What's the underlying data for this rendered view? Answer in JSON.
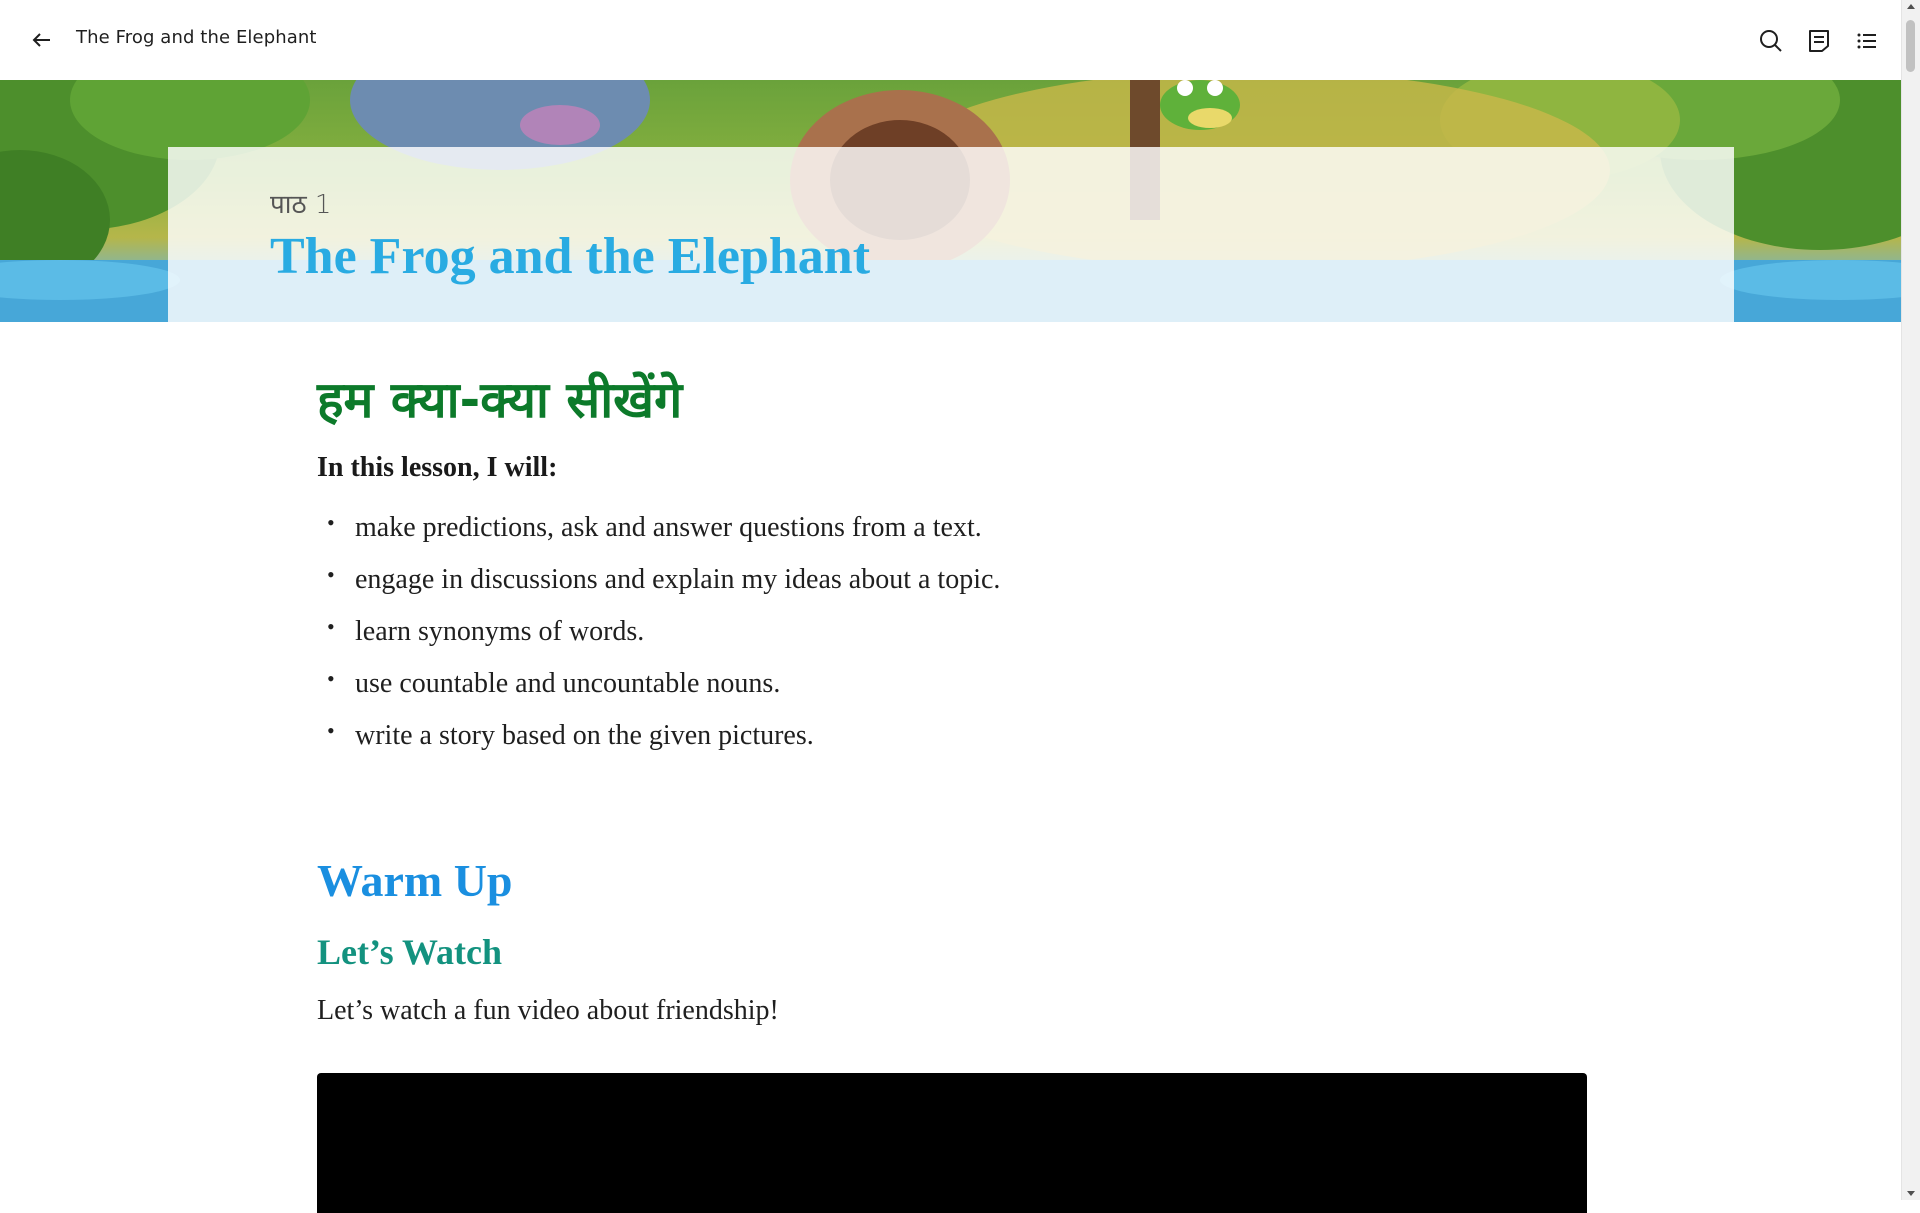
{
  "toolbar": {
    "book_title": "The Frog and the Elephant",
    "icons": [
      "back-arrow-icon",
      "search-icon",
      "notes-icon",
      "table-of-contents-icon"
    ]
  },
  "banner": {
    "lesson_number": "पाठ 1",
    "lesson_title": "The Frog and the Elephant"
  },
  "objectives": {
    "heading": "हम क्या-क्या सीखेंगे",
    "intro": "In this lesson, I will:",
    "items": [
      "make predictions, ask and answer questions from a text.",
      "engage in discussions and explain my ideas about a topic.",
      "learn synonyms of words.",
      "use countable and uncountable nouns.",
      "write a story based on the given pictures."
    ]
  },
  "warm_up": {
    "heading": "Warm Up",
    "subheading": "Let’s Watch",
    "text": "Let’s watch a fun video about friendship!"
  },
  "colors": {
    "title_blue": "#29abe2",
    "hindi_green": "#0c7a2a",
    "warmup_blue": "#1a8fe0",
    "watch_teal": "#13927f"
  }
}
